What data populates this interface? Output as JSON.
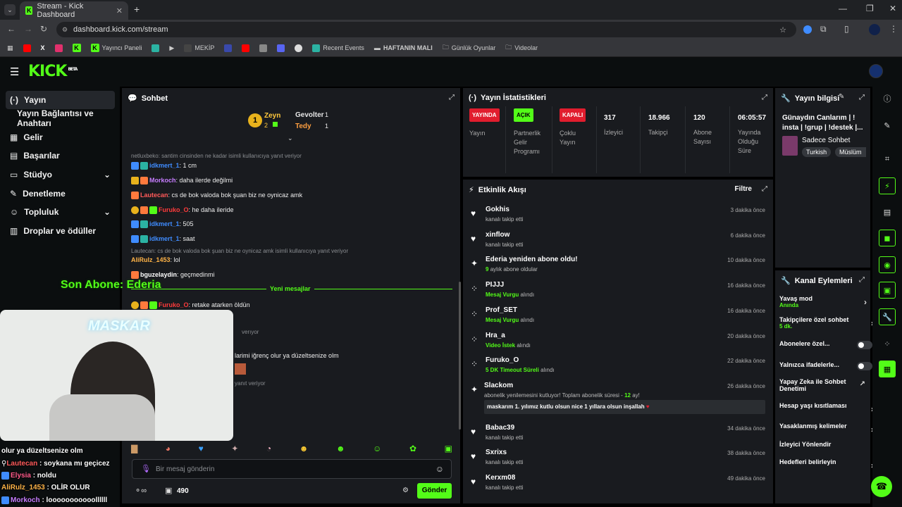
{
  "browser": {
    "tab_title": "Stream - Kick Dashboard",
    "url": "dashboard.kick.com/stream",
    "bookmarks": [
      "Yayıncı Paneli",
      "MEKİP",
      "Recent Events",
      "HAFTANIN MALI",
      "Günlük Oyunlar",
      "Videolar"
    ]
  },
  "brand": {
    "logo": "KICK",
    "beta": "BETA",
    "accent": "#53fc18"
  },
  "sidebar": {
    "items": [
      {
        "label": "Yayın"
      },
      {
        "label": "Yayın Bağlantısı ve Anahtarı"
      },
      {
        "label": "Gelir"
      },
      {
        "label": "Başarılar"
      },
      {
        "label": "Stüdyo"
      },
      {
        "label": "Denetleme"
      },
      {
        "label": "Topluluk"
      },
      {
        "label": "Droplar ve ödüller"
      }
    ]
  },
  "chat": {
    "title": "Sohbet",
    "leaderboard": {
      "rank": "1",
      "first": {
        "name": "Zeyn",
        "count": "2"
      },
      "gifts": [
        {
          "name": "Gevolter",
          "count": "1"
        },
        {
          "name": "Tedy",
          "count": "1"
        }
      ]
    },
    "messages": [
      {
        "kind": "reply",
        "text": "netluxbeko: santim cinsinden ne kadar isimli kullanıcıya yanıt veriyor"
      },
      {
        "kind": "msg",
        "user": "idkmert_1",
        "user_color": "#3f8cff",
        "text": ": 1 cm"
      },
      {
        "kind": "msg",
        "user": "Morkoch",
        "user_color": "#c77dff",
        "text": ": daha ilerde değilmi"
      },
      {
        "kind": "msg",
        "user": "Lautecan",
        "user_color": "#ff5a5a",
        "text": ": cs de bok valoda bok şuan biz ne oynicaz amk"
      },
      {
        "kind": "msg",
        "user": "Furuko_O",
        "user_color": "#ff3b3b",
        "text": ": he daha ileride"
      },
      {
        "kind": "msg",
        "user": "idkmert_1",
        "user_color": "#3f8cff",
        "text": ": 505"
      },
      {
        "kind": "msg",
        "user": "idkmert_1",
        "user_color": "#3f8cff",
        "text": ": saat"
      },
      {
        "kind": "reply",
        "text": "Lautecan: cs de bok valoda bok şuan biz ne oynicaz amk isimli kullanıcıya yanıt veriyor"
      },
      {
        "kind": "msg",
        "user": "AliRulz_1453",
        "user_color": "#ffb347",
        "text": ": lol"
      },
      {
        "kind": "msg",
        "user": "bguzelaydin",
        "user_color": "#ffffff",
        "text": ": geçmedinmi"
      },
      {
        "kind": "divider",
        "text": "Yeni mesajlar"
      },
      {
        "kind": "msg",
        "user": "Furuko_O",
        "user_color": "#ff3b3b",
        "text": ": retake atarken öldün"
      },
      {
        "kind": "reply",
        "text": "verıyor"
      },
      {
        "kind": "msg",
        "user": "",
        "user_color": "#ffffff",
        "text": "larimi iğrenç olur ya düzeltsenize olm"
      },
      {
        "kind": "reply",
        "text": "yanıt veriyor"
      }
    ],
    "input_placeholder": "Bir mesaj gönderin",
    "points": "490",
    "send_label": "Gönder"
  },
  "overlay": {
    "last_sub": "Son Abone: Ederia",
    "webcam_text": "MASKAR",
    "chat_lines": [
      {
        "user": "",
        "text": "olur ya düzeltsenize olm",
        "color": "#ffffff"
      },
      {
        "user": "Lautecan",
        "text": " : soykana mı geçicez",
        "color": "#ff5a5a"
      },
      {
        "user": "Elysia",
        "text": " : noldu",
        "color": "#ff5a8a"
      },
      {
        "user": "AliRulz_1453",
        "text": " : OLİR OLUR",
        "color": "#ffb347"
      },
      {
        "user": "Morkoch",
        "text": " : looooooooooollllll",
        "color": "#c77dff"
      }
    ]
  },
  "stats": {
    "title": "Yayın İstatistikleri",
    "items": [
      {
        "pill": "YAYINDA",
        "pill_color": "#e11d2e",
        "label": "Yayın"
      },
      {
        "pill": "AÇIK",
        "pill_color": "#53fc18",
        "label": "Partnerlik Gelir Programı"
      },
      {
        "pill": "KAPALI",
        "pill_color": "#e11d2e",
        "label": "Çoklu Yayın"
      },
      {
        "value": "317",
        "label": "İzleyici"
      },
      {
        "value": "18.966",
        "label": "Takipçi"
      },
      {
        "value": "120",
        "label": "Abone Sayısı"
      },
      {
        "value": "06:05:57",
        "label": "Yayında Olduğu Süre"
      }
    ]
  },
  "activity": {
    "title": "Etkinlik Akışı",
    "filter": "Filtre",
    "items": [
      {
        "icon": "heart-icon",
        "name": "Gokhis",
        "sub": "kanalı takip etti",
        "hl": "",
        "time": "3 dakika önce"
      },
      {
        "icon": "heart-icon",
        "name": "xinflow",
        "sub": "kanalı takip etti",
        "hl": "",
        "time": "6 dakika önce"
      },
      {
        "icon": "star-icon",
        "name": "Ederia yeniden abone oldu!",
        "sub": "aylık abone oldular",
        "hl": "9",
        "time": "10 dakika önce"
      },
      {
        "icon": "kicks-icon",
        "name": "PIJJJ",
        "sub": "alındı",
        "hl": "Mesaj Vurgu",
        "time": "16 dakika önce"
      },
      {
        "icon": "kicks-icon",
        "name": "Prof_SET",
        "sub": "alındı",
        "hl": "Mesaj Vurgu",
        "time": "16 dakika önce"
      },
      {
        "icon": "kicks-icon",
        "name": "Hra_a",
        "sub": "alındı",
        "hl": "Video İstek",
        "time": "20 dakika önce"
      },
      {
        "icon": "kicks-icon",
        "name": "Furuko_O",
        "sub": "alındı",
        "hl": "5 DK Timeout Süreli",
        "time": "22 dakika önce"
      },
      {
        "icon": "star-icon",
        "name": "Slackom",
        "sub": "abonelik yenilemesini kutluyor! Toplam abonelik süresi -",
        "hl": "12",
        "sub2": "ay!",
        "quote": "maskarım 1. yılımız kutlu olsun nice 1 yıllara olsun inşallah",
        "time": "26 dakika önce"
      },
      {
        "icon": "heart-icon",
        "name": "Babac39",
        "sub": "kanalı takip etti",
        "hl": "",
        "time": "34 dakika önce"
      },
      {
        "icon": "heart-icon",
        "name": "Sxrixs",
        "sub": "kanalı takip etti",
        "hl": "",
        "time": "38 dakika önce"
      },
      {
        "icon": "heart-icon",
        "name": "Kerxm08",
        "sub": "kanalı takip etti",
        "hl": "",
        "time": "49 dakika önce"
      }
    ]
  },
  "stream_info": {
    "title": "Yayın bilgisi",
    "stream_title": "Günaydın Canlarım | ! insta | !grup | !destek |...",
    "category": "Sadece Sohbet",
    "tags": [
      "Turkish",
      "Müslüm"
    ]
  },
  "channel_actions": {
    "title": "Kanal Eylemleri",
    "items": [
      {
        "label": "Yavaş mod",
        "sub": "Anında",
        "ctrl": "chevron"
      },
      {
        "label": "Takipçilere özel sohbet",
        "sub": "5 dk.",
        "ctrl": "chevron"
      },
      {
        "label": "Abonelere özel...",
        "sub": "",
        "ctrl": "toggle"
      },
      {
        "label": "Yalnızca ifadelerle...",
        "sub": "",
        "ctrl": "toggle"
      },
      {
        "label": "Yapay Zeka ile Sohbet Denetimi",
        "sub": "",
        "ctrl": "external"
      },
      {
        "label": "Hesap yaşı kısıtlaması",
        "sub": "",
        "ctrl": "chevron"
      },
      {
        "label": "Yasaklanmış kelimeler",
        "sub": "",
        "ctrl": "chevron"
      },
      {
        "label": "İzleyici Yönlendir",
        "sub": "",
        "ctrl": "none"
      },
      {
        "label": "Hedefleri belirleyin",
        "sub": "",
        "ctrl": "chevron"
      }
    ]
  }
}
